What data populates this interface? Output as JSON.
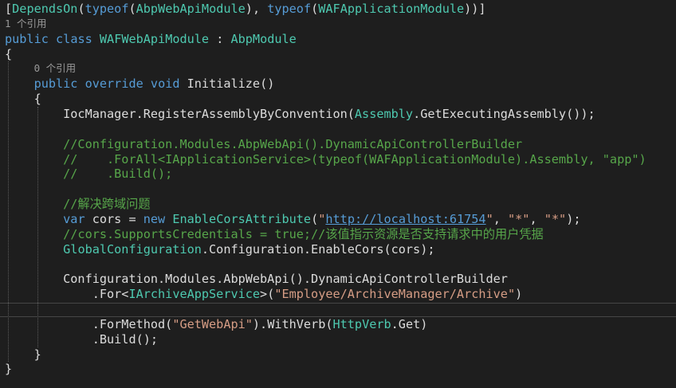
{
  "editor": {
    "background": "#1e1e1e",
    "colors": {
      "plain": "#dcdcdc",
      "keyword": "#569cd6",
      "type": "#4ec9b0",
      "comment": "#57a64a",
      "string": "#d69d85",
      "link": "#569cd6",
      "lens": "#999999"
    },
    "lines": [
      {
        "tokens": [
          {
            "t": "[",
            "c": "plain"
          },
          {
            "t": "DependsOn",
            "c": "type"
          },
          {
            "t": "(",
            "c": "plain"
          },
          {
            "t": "typeof",
            "c": "keyword"
          },
          {
            "t": "(",
            "c": "plain"
          },
          {
            "t": "AbpWebApiModule",
            "c": "type"
          },
          {
            "t": "), ",
            "c": "plain"
          },
          {
            "t": "typeof",
            "c": "keyword"
          },
          {
            "t": "(",
            "c": "plain"
          },
          {
            "t": "WAFApplicationModule",
            "c": "type"
          },
          {
            "t": "))]",
            "c": "plain"
          }
        ]
      },
      {
        "lens": "1 个引用"
      },
      {
        "tokens": [
          {
            "t": "public",
            "c": "keyword"
          },
          {
            "t": " ",
            "c": "plain"
          },
          {
            "t": "class",
            "c": "keyword"
          },
          {
            "t": " ",
            "c": "plain"
          },
          {
            "t": "WAFWebApiModule",
            "c": "type"
          },
          {
            "t": " : ",
            "c": "plain"
          },
          {
            "t": "AbpModule",
            "c": "type"
          }
        ]
      },
      {
        "tokens": [
          {
            "t": "{",
            "c": "plain"
          }
        ]
      },
      {
        "lens": "0 个引用",
        "indent": 4
      },
      {
        "tokens": [
          {
            "t": "    ",
            "c": "plain"
          },
          {
            "t": "public",
            "c": "keyword"
          },
          {
            "t": " ",
            "c": "plain"
          },
          {
            "t": "override",
            "c": "keyword"
          },
          {
            "t": " ",
            "c": "plain"
          },
          {
            "t": "void",
            "c": "keyword"
          },
          {
            "t": " Initialize()",
            "c": "plain"
          }
        ]
      },
      {
        "tokens": [
          {
            "t": "    {",
            "c": "plain"
          }
        ]
      },
      {
        "tokens": [
          {
            "t": "        IocManager.RegisterAssemblyByConvention(",
            "c": "plain"
          },
          {
            "t": "Assembly",
            "c": "type"
          },
          {
            "t": ".GetExecutingAssembly());",
            "c": "plain"
          }
        ]
      },
      {
        "tokens": []
      },
      {
        "tokens": [
          {
            "t": "        //Configuration.Modules.AbpWebApi().DynamicApiControllerBuilder",
            "c": "comment"
          }
        ]
      },
      {
        "tokens": [
          {
            "t": "        //    .ForAll<IApplicationService>(typeof(WAFApplicationModule).Assembly, \"app\")",
            "c": "comment"
          }
        ]
      },
      {
        "tokens": [
          {
            "t": "        //    .Build();",
            "c": "comment"
          }
        ]
      },
      {
        "tokens": []
      },
      {
        "tokens": [
          {
            "t": "        //解决跨域问题",
            "c": "comment"
          }
        ]
      },
      {
        "tokens": [
          {
            "t": "        ",
            "c": "plain"
          },
          {
            "t": "var",
            "c": "keyword"
          },
          {
            "t": " cors = ",
            "c": "plain"
          },
          {
            "t": "new",
            "c": "keyword"
          },
          {
            "t": " ",
            "c": "plain"
          },
          {
            "t": "EnableCorsAttribute",
            "c": "type"
          },
          {
            "t": "(",
            "c": "plain"
          },
          {
            "t": "\"",
            "c": "string"
          },
          {
            "t": "http://localhost:61754",
            "c": "link"
          },
          {
            "t": "\"",
            "c": "string"
          },
          {
            "t": ", ",
            "c": "plain"
          },
          {
            "t": "\"*\"",
            "c": "string"
          },
          {
            "t": ", ",
            "c": "plain"
          },
          {
            "t": "\"*\"",
            "c": "string"
          },
          {
            "t": ");",
            "c": "plain"
          }
        ]
      },
      {
        "tokens": [
          {
            "t": "        //cors.SupportsCredentials = true;//该值指示资源是否支持请求中的用户凭据",
            "c": "comment"
          }
        ]
      },
      {
        "tokens": [
          {
            "t": "        ",
            "c": "plain"
          },
          {
            "t": "GlobalConfiguration",
            "c": "type"
          },
          {
            "t": ".Configuration.EnableCors(cors);",
            "c": "plain"
          }
        ]
      },
      {
        "tokens": []
      },
      {
        "tokens": [
          {
            "t": "        Configuration.Modules.AbpWebApi().DynamicApiControllerBuilder",
            "c": "plain"
          }
        ]
      },
      {
        "tokens": [
          {
            "t": "            .For<",
            "c": "plain"
          },
          {
            "t": "IArchiveAppService",
            "c": "type"
          },
          {
            "t": ">(",
            "c": "plain"
          },
          {
            "t": "\"Employee/ArchiveManager/Archive\"",
            "c": "string"
          },
          {
            "t": ")",
            "c": "plain"
          }
        ]
      },
      {
        "tokens": [],
        "cursor": true
      },
      {
        "tokens": [
          {
            "t": "            .ForMethod(",
            "c": "plain"
          },
          {
            "t": "\"GetWebApi\"",
            "c": "string"
          },
          {
            "t": ").WithVerb(",
            "c": "plain"
          },
          {
            "t": "HttpVerb",
            "c": "type"
          },
          {
            "t": ".Get)",
            "c": "plain"
          }
        ]
      },
      {
        "tokens": [
          {
            "t": "            .Build();",
            "c": "plain"
          }
        ]
      },
      {
        "tokens": [
          {
            "t": "    }",
            "c": "plain"
          }
        ]
      },
      {
        "tokens": [
          {
            "t": "}",
            "c": "plain"
          }
        ]
      }
    ]
  }
}
